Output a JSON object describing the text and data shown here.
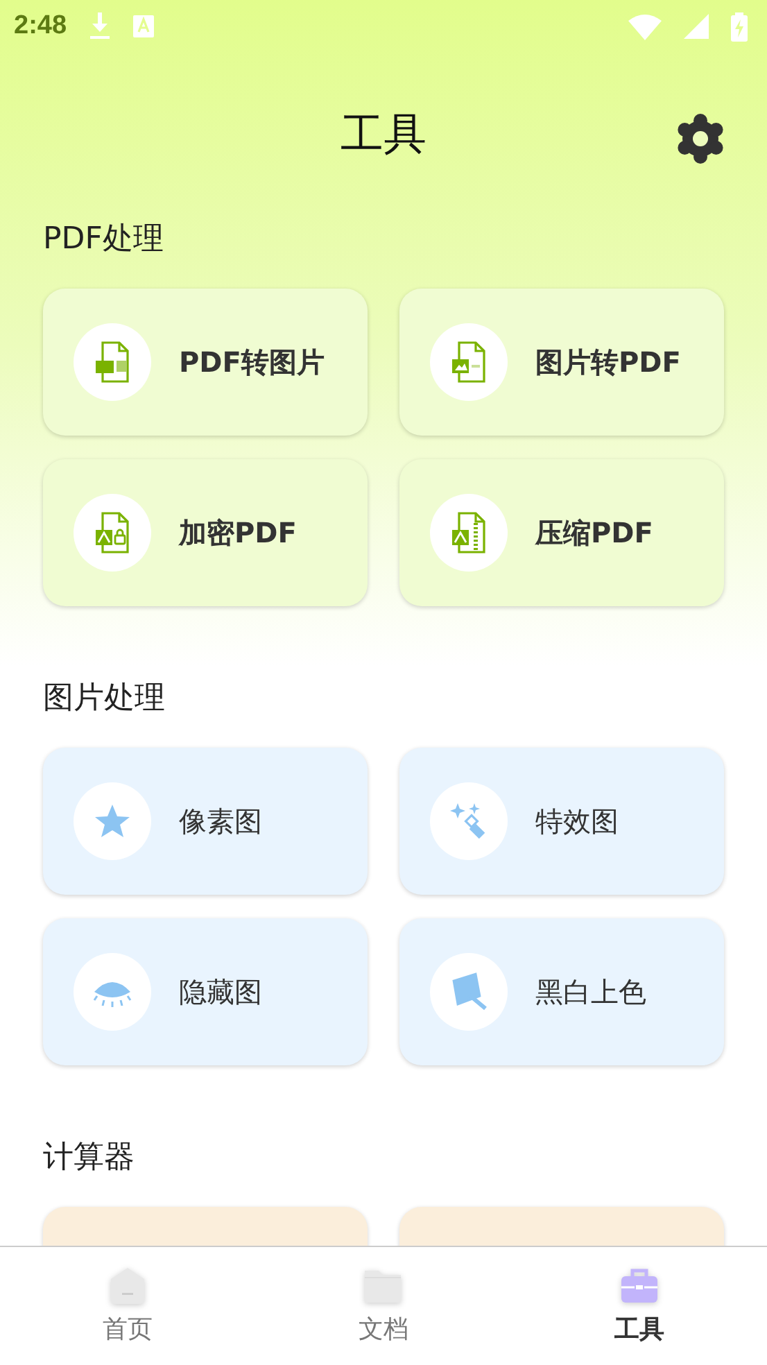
{
  "status_bar": {
    "time": "2:48"
  },
  "header": {
    "title": "工具"
  },
  "sections": [
    {
      "title": "PDF处理",
      "kind": "pdf",
      "tiles": [
        {
          "label": "PDF转图片"
        },
        {
          "label": "图片转PDF"
        },
        {
          "label": "加密PDF"
        },
        {
          "label": "压缩PDF"
        }
      ]
    },
    {
      "title": "图片处理",
      "kind": "image",
      "tiles": [
        {
          "label": "像素图"
        },
        {
          "label": "特效图"
        },
        {
          "label": "隐藏图"
        },
        {
          "label": "黑白上色"
        }
      ]
    },
    {
      "title": "计算器",
      "kind": "calc",
      "tiles": [
        {
          "kind": "partial"
        },
        {
          "kind": "partial"
        }
      ]
    }
  ],
  "bottom_nav": [
    {
      "label": "首页",
      "selected": false
    },
    {
      "label": "文档",
      "selected": false
    },
    {
      "label": "工具",
      "selected": true
    }
  ]
}
